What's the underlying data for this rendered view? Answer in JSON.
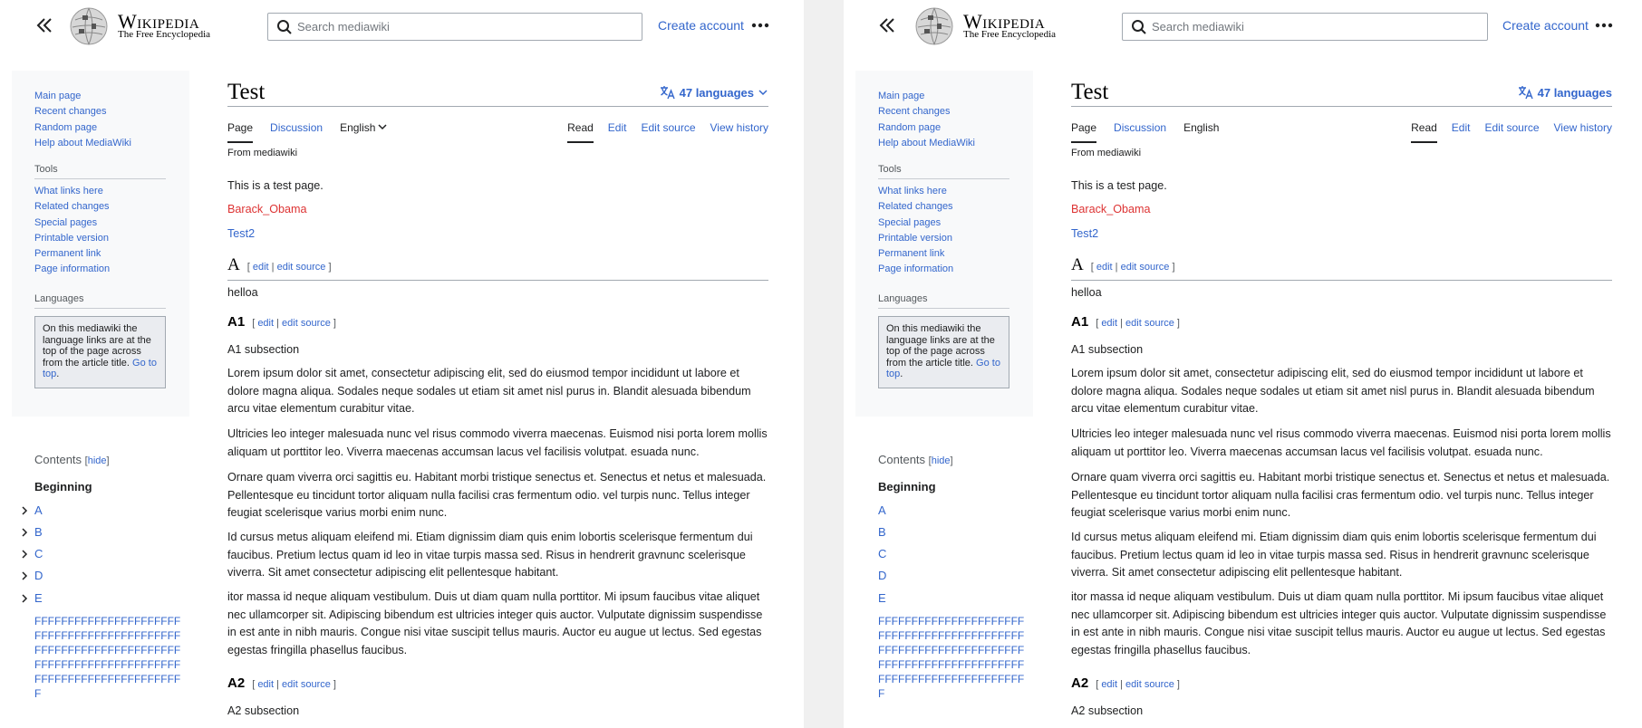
{
  "panes": [
    {
      "header": {
        "wordmark": "Wikipedia",
        "tagline": "The Free Encyclopedia",
        "search_placeholder": "Search mediawiki",
        "create_account": "Create account"
      },
      "sidebar": {
        "nav": [
          "Main page",
          "Recent changes",
          "Random page",
          "Help about MediaWiki"
        ],
        "tools_heading": "Tools",
        "tools": [
          "What links here",
          "Related changes",
          "Special pages",
          "Printable version",
          "Permanent link",
          "Page information"
        ],
        "languages_heading": "Languages",
        "lang_note": "On this mediawiki the language links are at the top of the page across from the article title.",
        "lang_link": "Go to top",
        "lang_end": "."
      },
      "toc": {
        "title": "Contents",
        "hide": "hide",
        "beginning": "Beginning",
        "items": [
          "A",
          "B",
          "C",
          "D",
          "E"
        ],
        "long_item": "FFFFFFFFFFFFFFFFFFFFFFFFFFFFFFFFFFFFFFFFFFFFFFFFFFFFFFFFFFFFFFFFFFFFFFFFFFFFFFFFFFFFFFFFFFFFFFFFFFFFFFFFFFFFFFF"
      },
      "content": {
        "title": "Test",
        "languages": "47 languages",
        "tabs_left": [
          "Page",
          "Discussion",
          "English"
        ],
        "tabs_right": [
          "Read",
          "Edit",
          "Edit source",
          "View history"
        ],
        "from": "From mediawiki",
        "intro": "This is a test page.",
        "link_red": "Barack_Obama",
        "link_blue": "Test2",
        "h_a": "A",
        "helloa": "helloa",
        "h_a1": "A1",
        "a1_sub": "A1 subsection",
        "edit": "edit",
        "edit_source": "edit source",
        "paras": [
          "Lorem ipsum dolor sit amet, consectetur adipiscing elit, sed do eiusmod tempor incididunt ut labore et dolore magna aliqua. Sodales neque sodales ut etiam sit amet nisl purus in. Blandit alesuada bibendum arcu vitae elementum curabitur vitae.",
          "Ultricies leo integer malesuada nunc vel risus commodo viverra maecenas. Euismod nisi porta lorem mollis aliquam ut porttitor leo. Viverra maecenas accumsan lacus vel facilisis volutpat. esuada nunc.",
          "Ornare quam viverra orci sagittis eu. Habitant morbi tristique senectus et. Senectus et netus et malesuada. Pellentesque eu tincidunt tortor aliquam nulla facilisi cras fermentum odio. vel turpis nunc. Tellus integer feugiat scelerisque varius morbi enim nunc.",
          "Id cursus metus aliquam eleifend mi. Etiam dignissim diam quis enim lobortis scelerisque fermentum dui faucibus. Pretium lectus quam id leo in vitae turpis massa sed. Risus in hendrerit gravnunc scelerisque viverra. Sit amet consectetur adipiscing elit pellentesque habitant.",
          "itor massa id neque aliquam vestibulum. Duis ut diam quam nulla porttitor. Mi ipsum faucibus vitae aliquet nec ullamcorper sit. Adipiscing bibendum est ultricies integer quis auctor. Vulputate dignissim suspendisse in est ante in nibh mauris. Congue nisi vitae suscipit tellus mauris. Auctor eu augue ut lectus. Sed egestas egestas fringilla phasellus faucibus."
        ],
        "h_a2": "A2",
        "a2_sub": "A2 subsection"
      }
    },
    {
      "header": {
        "wordmark": "Wikipedia",
        "tagline": "The Free Encyclopedia",
        "search_placeholder": "Search mediawiki",
        "create_account": "Create account"
      },
      "sidebar": {
        "nav": [
          "Main page",
          "Recent changes",
          "Random page",
          "Help about MediaWiki"
        ],
        "tools_heading": "Tools",
        "tools": [
          "What links here",
          "Related changes",
          "Special pages",
          "Printable version",
          "Permanent link",
          "Page information"
        ],
        "languages_heading": "Languages",
        "lang_note": "On this mediawiki the language links are at the top of the page across from the article title.",
        "lang_link": "Go to top",
        "lang_end": "."
      },
      "toc": {
        "title": "Contents",
        "hide": "hide",
        "beginning": "Beginning",
        "items": [
          "A",
          "B",
          "C",
          "D",
          "E"
        ],
        "long_item": "FFFFFFFFFFFFFFFFFFFFFFFFFFFFFFFFFFFFFFFFFFFFFFFFFFFFFFFFFFFFFFFFFFFFFFFFFFFFFFFFFFFFFFFFFFFFFFFFFFFFFFFFFFFFFFF"
      },
      "content": {
        "title": "Test",
        "languages": "47 languages",
        "tabs_left": [
          "Page",
          "Discussion",
          "English"
        ],
        "tabs_right": [
          "Read",
          "Edit",
          "Edit source",
          "View history"
        ],
        "from": "From mediawiki",
        "intro": "This is a test page.",
        "link_red": "Barack_Obama",
        "link_blue": "Test2",
        "h_a": "A",
        "helloa": "helloa",
        "h_a1": "A1",
        "a1_sub": "A1 subsection",
        "edit": "edit",
        "edit_source": "edit source",
        "paras": [
          "Lorem ipsum dolor sit amet, consectetur adipiscing elit, sed do eiusmod tempor incididunt ut labore et dolore magna aliqua. Sodales neque sodales ut etiam sit amet nisl purus in. Blandit alesuada bibendum arcu vitae elementum curabitur vitae.",
          "Ultricies leo integer malesuada nunc vel risus commodo viverra maecenas. Euismod nisi porta lorem mollis aliquam ut porttitor leo. Viverra maecenas accumsan lacus vel facilisis volutpat. esuada nunc.",
          "Ornare quam viverra orci sagittis eu. Habitant morbi tristique senectus et. Senectus et netus et malesuada. Pellentesque eu tincidunt tortor aliquam nulla facilisi cras fermentum odio. vel turpis nunc. Tellus integer feugiat scelerisque varius morbi enim nunc.",
          "Id cursus metus aliquam eleifend mi. Etiam dignissim diam quis enim lobortis scelerisque fermentum dui faucibus. Pretium lectus quam id leo in vitae turpis massa sed. Risus in hendrerit gravnunc scelerisque viverra. Sit amet consectetur adipiscing elit pellentesque habitant.",
          "itor massa id neque aliquam vestibulum. Duis ut diam quam nulla porttitor. Mi ipsum faucibus vitae aliquet nec ullamcorper sit. Adipiscing bibendum est ultricies integer quis auctor. Vulputate dignissim suspendisse in est ante in nibh mauris. Congue nisi vitae suscipit tellus mauris. Auctor eu augue ut lectus. Sed egestas egestas fringilla phasellus faucibus."
        ],
        "h_a2": "A2",
        "a2_sub": "A2 subsection"
      }
    }
  ]
}
